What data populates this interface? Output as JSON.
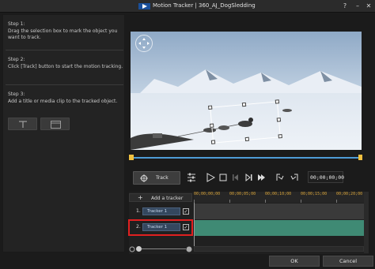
{
  "window": {
    "title": "Motion Tracker | 360_AJ_DogSledding",
    "help_glyph": "?",
    "minimize_glyph": "–",
    "close_glyph": "✕"
  },
  "steps": [
    {
      "title": "Step 1:",
      "text": "Drag the selection box to mark the object you want to track."
    },
    {
      "title": "Step 2:",
      "text": "Click [Track] button to start the motion tracking."
    },
    {
      "title": "Step 3:",
      "text": "Add a title or media clip to the tracked object."
    }
  ],
  "tools": {
    "title_icon": "title-icon",
    "media_icon": "media-clip-icon"
  },
  "player": {
    "track_label": "Track",
    "timecode": "00;00;00;00",
    "icons": [
      "track-crosshair-icon",
      "track-settings-icon",
      "play-icon",
      "stop-icon",
      "previous-frame-icon",
      "next-frame-icon",
      "step-forward-icon",
      "mark-in-icon",
      "mark-out-icon"
    ]
  },
  "timeline": {
    "add_tracker_label": "Add a tracker",
    "ruler_labels": [
      "00;00;00;00",
      "00;00;05;00",
      "00;00;10;00",
      "00;00;15;00",
      "00;00;20;00"
    ],
    "trackers": [
      {
        "index": "1.",
        "name": "Tracker 1",
        "checked": "✓"
      },
      {
        "index": "2.",
        "name": "Tracker 1",
        "checked": "✓"
      }
    ]
  },
  "footer": {
    "ok_label": "OK",
    "cancel_label": "Cancel"
  },
  "colors": {
    "accent": "#4e9cd6",
    "scrub_marker": "#f0c040",
    "lane_fill": "#3f8a74",
    "highlight": "#e02020"
  }
}
